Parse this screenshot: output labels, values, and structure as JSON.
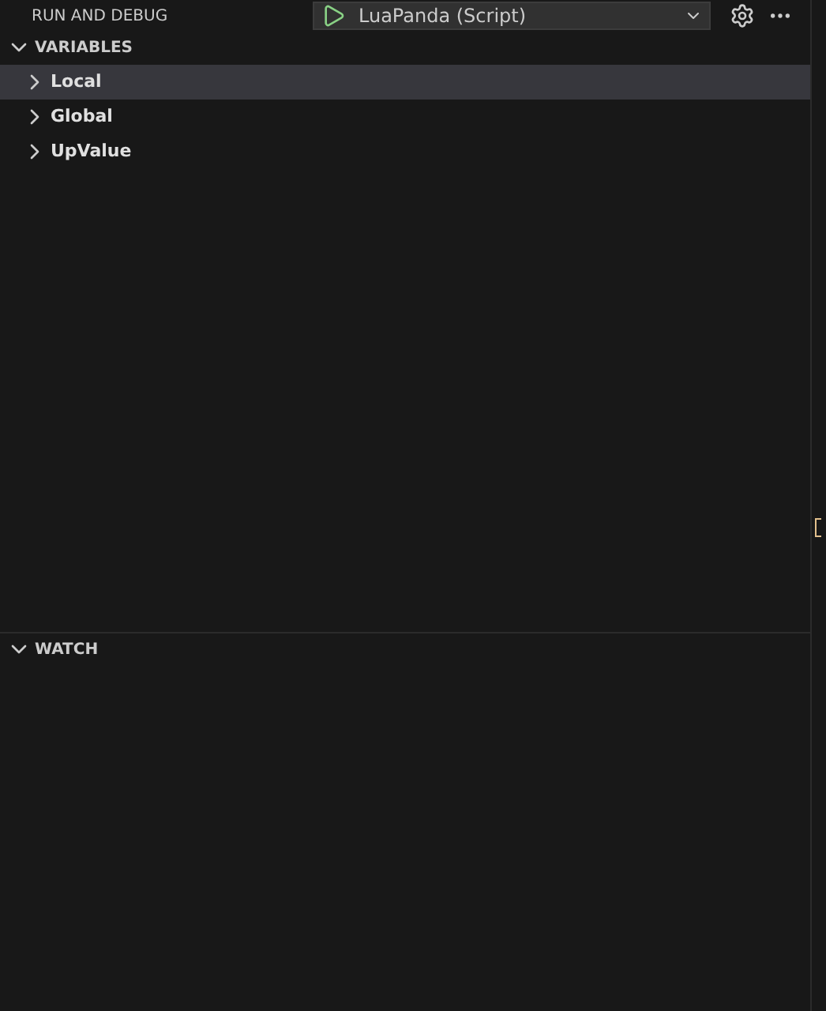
{
  "header": {
    "title": "RUN AND DEBUG",
    "config": "LuaPanda (Script)"
  },
  "variables": {
    "title": "VARIABLES",
    "expanded": true,
    "items": [
      {
        "label": "Local",
        "selected": true,
        "expanded": false
      },
      {
        "label": "Global",
        "selected": false,
        "expanded": false
      },
      {
        "label": "UpValue",
        "selected": false,
        "expanded": false
      }
    ]
  },
  "watch": {
    "title": "WATCH",
    "expanded": true
  }
}
